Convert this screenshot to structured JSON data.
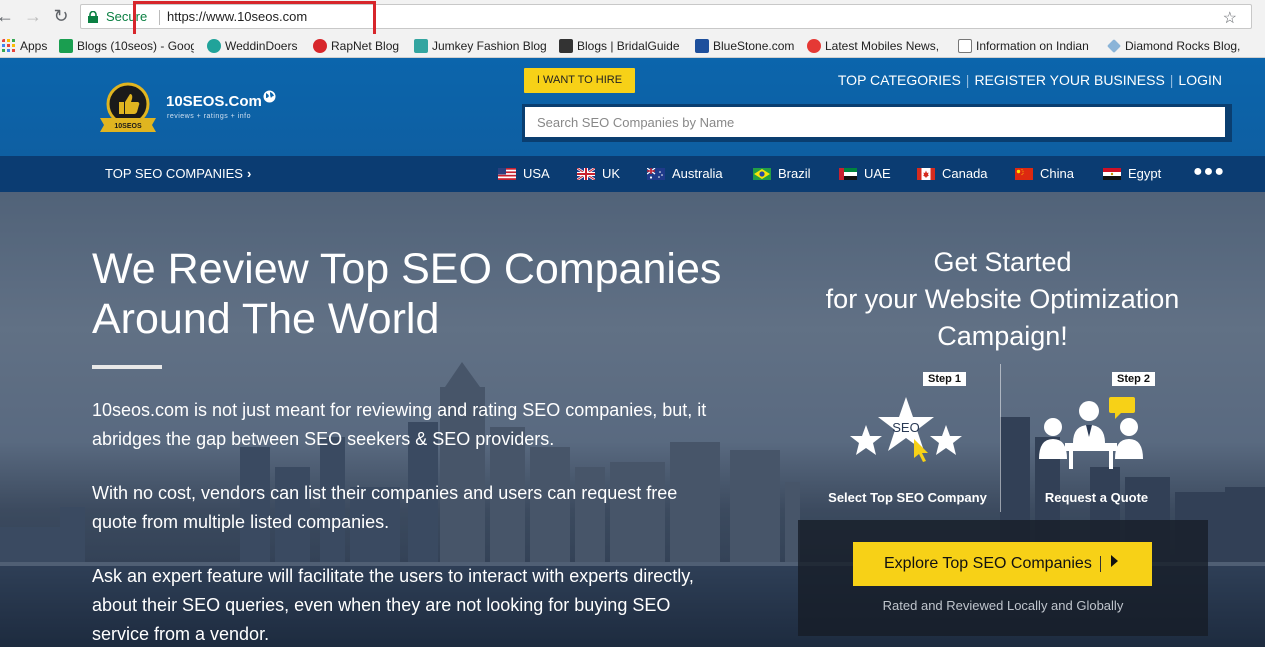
{
  "browser": {
    "secure_label": "Secure",
    "url": "https://www.10seos.com",
    "bookmarks": [
      {
        "label": "Apps",
        "color": "#e8453c"
      },
      {
        "label": "Blogs (10seos) - Goog",
        "color": "#1a9e50"
      },
      {
        "label": "WeddinDoers",
        "color": "#21a39a"
      },
      {
        "label": "RapNet Blog",
        "color": "#d7262b"
      },
      {
        "label": "Jumkey Fashion Blog",
        "color": "#33a5a0"
      },
      {
        "label": "Blogs | BridalGuide",
        "color": "#333333"
      },
      {
        "label": "BlueStone.com",
        "color": "#1d4f9c"
      },
      {
        "label": "Latest Mobiles News,",
        "color": "#e53935"
      },
      {
        "label": "Information on Indian",
        "color": "#777777"
      },
      {
        "label": "Diamond Rocks Blog,",
        "color": "#8ab4d8"
      }
    ]
  },
  "header": {
    "logo_text": "10SEOS.Com",
    "logo_tagline": "reviews + ratings + info",
    "badge_text": "10SEOS",
    "hire_button": "I WANT TO HIRE",
    "links": [
      "TOP CATEGORIES",
      "REGISTER YOUR BUSINESS",
      "LOGIN"
    ],
    "search_placeholder": "Search SEO Companies by Name"
  },
  "country_bar": {
    "label": "TOP SEO COMPANIES",
    "countries": [
      "USA",
      "UK",
      "Australia",
      "Brazil",
      "UAE",
      "Canada",
      "China",
      "Egypt"
    ],
    "more": "●●●"
  },
  "hero": {
    "title_line1": "We Review Top SEO Companies",
    "title_line2": "Around The World",
    "paragraphs": [
      "10seos.com is not just meant for reviewing and rating SEO companies, but, it abridges the gap between SEO seekers & SEO providers.",
      "With no cost, vendors can list their companies and users can request free quote from multiple listed companies.",
      "Ask an expert feature will facilitate the users to interact with experts directly, about their SEO queries, even when they are not looking for buying SEO service from a vendor."
    ],
    "get_started_line1": "Get Started",
    "get_started_line2": "for your Website Optimization",
    "get_started_line3": "Campaign!",
    "step1_tag": "Step 1",
    "step1_icon_text": "SEO",
    "step1_label": "Select Top SEO Company",
    "step2_tag": "Step 2",
    "step2_label": "Request a Quote",
    "cta_button": "Explore Top SEO Companies",
    "cta_sub": "Rated and Reviewed Locally and Globally"
  },
  "colors": {
    "brand_blue": "#0b65ac",
    "nav_dark_blue": "#0b3c72",
    "accent_yellow": "#f7d117",
    "url_highlight_red": "#d7262b"
  }
}
